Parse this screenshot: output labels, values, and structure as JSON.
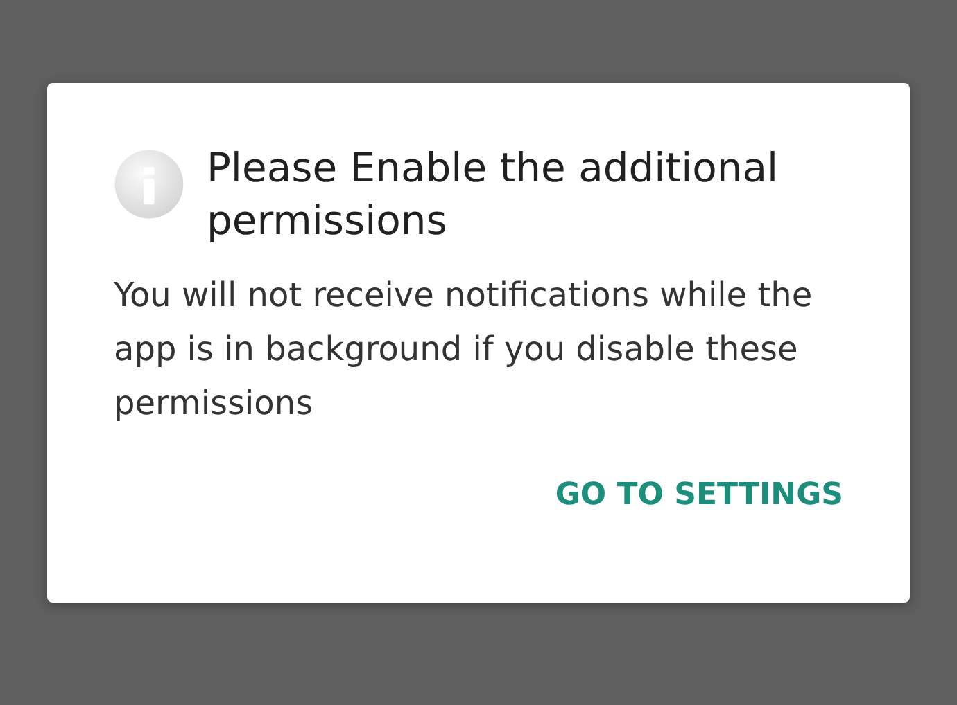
{
  "dialog": {
    "title": "Please Enable the additional permissions",
    "message": "You will not receive notifications while the app is in background if you disable these permissions",
    "buttons": [
      "GO TO SETTINGS"
    ]
  }
}
